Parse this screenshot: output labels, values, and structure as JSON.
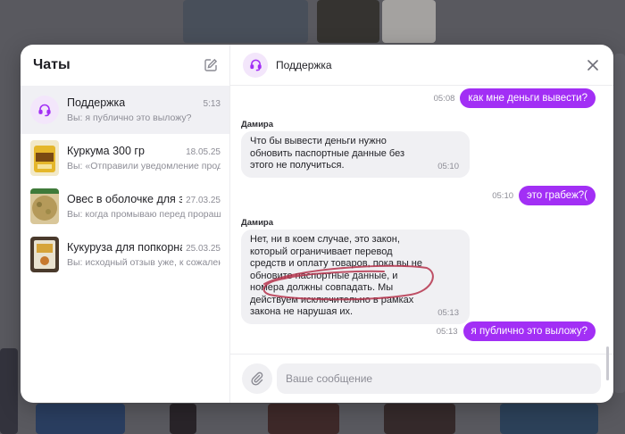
{
  "colors": {
    "accent": "#a22ff5",
    "support_avatar_bg": "#f3e6fb",
    "incoming_bubble": "#f0f0f3",
    "scribble": "#b5334b"
  },
  "sidebar": {
    "title": "Чаты",
    "compose_icon": "edit-pencil-icon",
    "chats": [
      {
        "name": "Поддержка",
        "time": "5:13",
        "preview": "Вы: я публично это выложу?",
        "avatar": "headset-icon"
      },
      {
        "name": "Куркума 300 гр",
        "time": "18.05.25",
        "preview": "Вы: «Отправили уведомление прод",
        "avatar": "product-thumb-turmeric"
      },
      {
        "name": "Овес в оболочке для за",
        "time": "27.03.25",
        "preview": "Вы: когда промываю перед проращ",
        "avatar": "product-thumb-oats"
      },
      {
        "name": "Кукуруза для попкорна",
        "time": "25.03.25",
        "preview": "Вы: исходный отзыв уже, к сожален",
        "avatar": "product-thumb-corn"
      }
    ]
  },
  "conversation": {
    "title": "Поддержка",
    "avatar_icon": "headset-icon",
    "close_icon": "close-icon",
    "messages": [
      {
        "direction": "out",
        "text": "как мне деньги вывести?",
        "time": "05:08"
      },
      {
        "direction": "in",
        "sender": "Дамира",
        "text": "Что бы вывести деньги нужно обновить паспортные данные без этого не получиться.",
        "time": "05:10"
      },
      {
        "direction": "out",
        "text": "это грабеж?(",
        "time": "05:10"
      },
      {
        "direction": "in",
        "sender": "Дамира",
        "text": "Нет, ни в коем случае, это закон, который ограничивает перевод средств и оплату товаров, пока вы не обновите паспортные данные, и номера должны совпадать. Мы действуем исключительно в рамках закона не нарушая их.",
        "time": "05:13"
      },
      {
        "direction": "out",
        "text": "я публично это выложу?",
        "time": "05:13"
      }
    ]
  },
  "composer": {
    "placeholder": "Ваше сообщение",
    "attach_icon": "paperclip-icon"
  }
}
